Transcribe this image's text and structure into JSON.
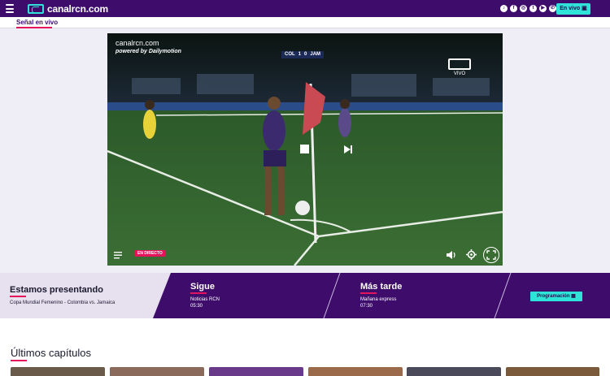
{
  "header": {
    "brand": "canalrcn.com",
    "live_button": "En vivo",
    "social_icons": [
      "tiktok-icon",
      "facebook-icon",
      "instagram-icon",
      "twitter-icon",
      "youtube-icon",
      "whatsapp-icon"
    ]
  },
  "subnav": {
    "label": "Señal en vivo"
  },
  "player": {
    "title": "canalrcn.com",
    "subtitle": "powered by Dailymotion",
    "score_team1": "COL",
    "score_value1": "1",
    "score_value2": "0",
    "score_team2": "JAM",
    "channel_label": "VIVO",
    "live_badge": "EN DIRECTO"
  },
  "schedule": {
    "now_heading": "Estamos presentando",
    "now_program": "Copa Mundial Femenino - Colombia vs. Jamaica",
    "next_heading": "Sigue",
    "next_program": "Noticias RCN",
    "next_time": "05:30",
    "later_heading": "Más tarde",
    "later_program": "Mañana express",
    "later_time": "07:30",
    "schedule_button": "Programación"
  },
  "latest": {
    "heading": "Últimos capítulos"
  },
  "colors": {
    "brand_purple": "#3e0d6b",
    "accent_cyan": "#2fe3d9",
    "accent_pink": "#e4135c"
  }
}
